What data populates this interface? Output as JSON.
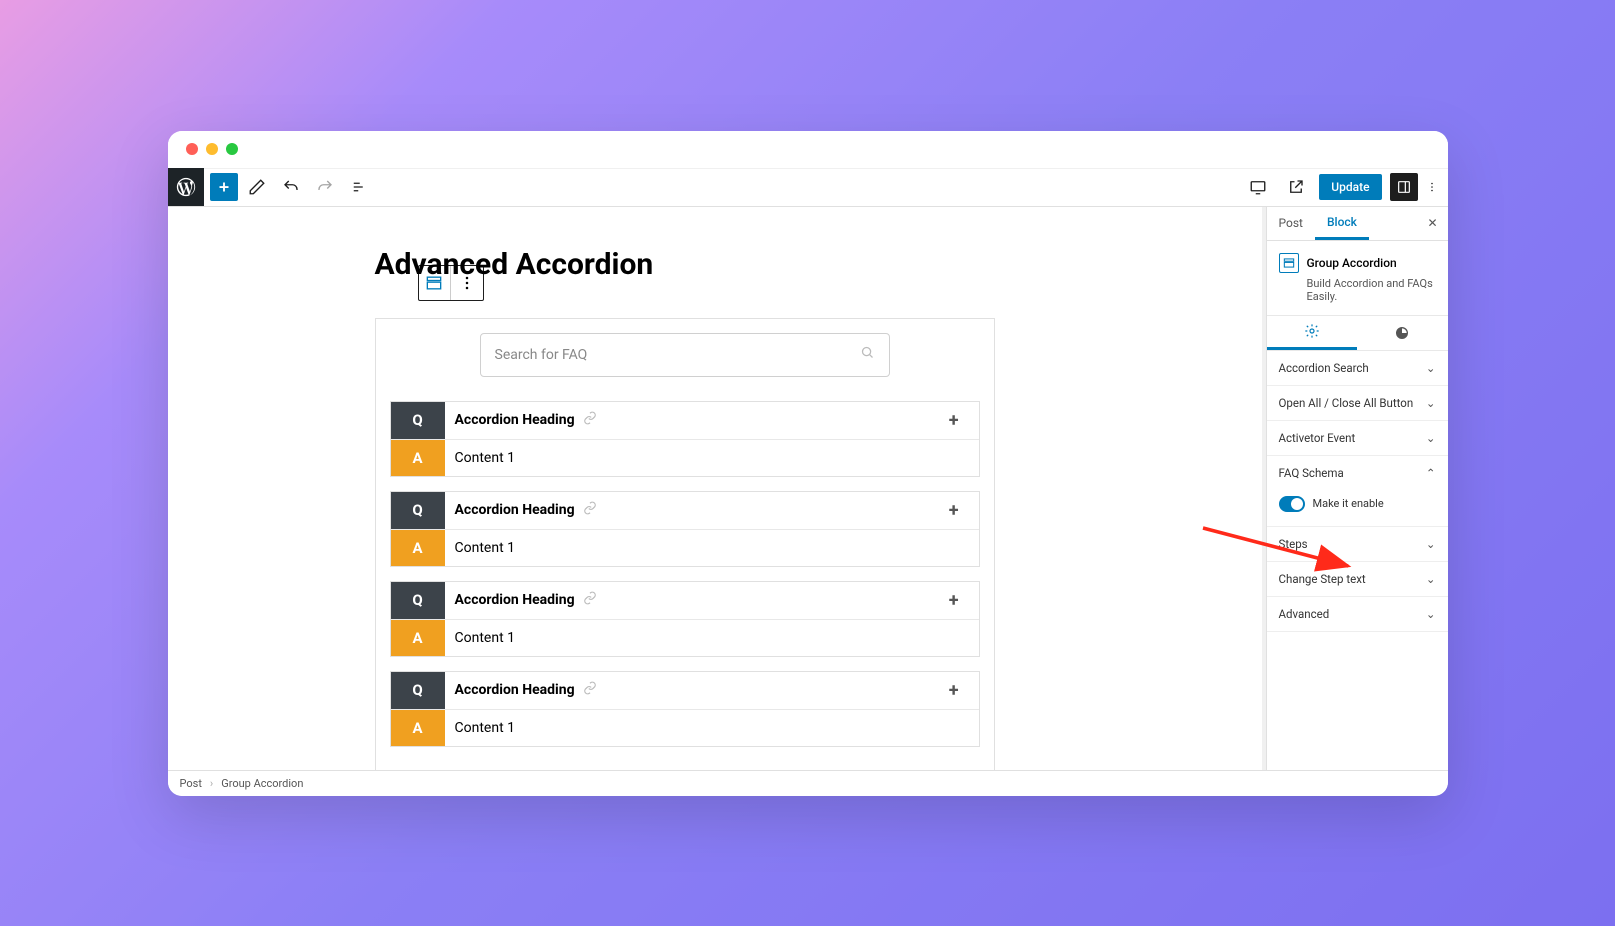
{
  "topbar": {
    "update_label": "Update"
  },
  "page": {
    "title": "Advanced Accordion"
  },
  "search": {
    "placeholder": "Search for FAQ"
  },
  "badges": {
    "q": "Q",
    "a": "A"
  },
  "accordions": [
    {
      "heading": "Accordion Heading",
      "content": "Content 1"
    },
    {
      "heading": "Accordion Heading",
      "content": "Content 1"
    },
    {
      "heading": "Accordion Heading",
      "content": "Content 1"
    },
    {
      "heading": "Accordion Heading",
      "content": "Content 1"
    }
  ],
  "sidebar": {
    "tabs": {
      "post": "Post",
      "block": "Block"
    },
    "block_name": "Group Accordion",
    "block_desc": "Build Accordion and FAQs Easily.",
    "panels": {
      "accordion_search": "Accordion Search",
      "open_close": "Open All / Close All Button",
      "activator": "Activetor Event",
      "faq_schema": "FAQ Schema",
      "faq_toggle_label": "Make it enable",
      "steps": "Steps",
      "change_step": "Change Step text",
      "advanced": "Advanced"
    }
  },
  "breadcrumb": {
    "root": "Post",
    "current": "Group Accordion"
  }
}
